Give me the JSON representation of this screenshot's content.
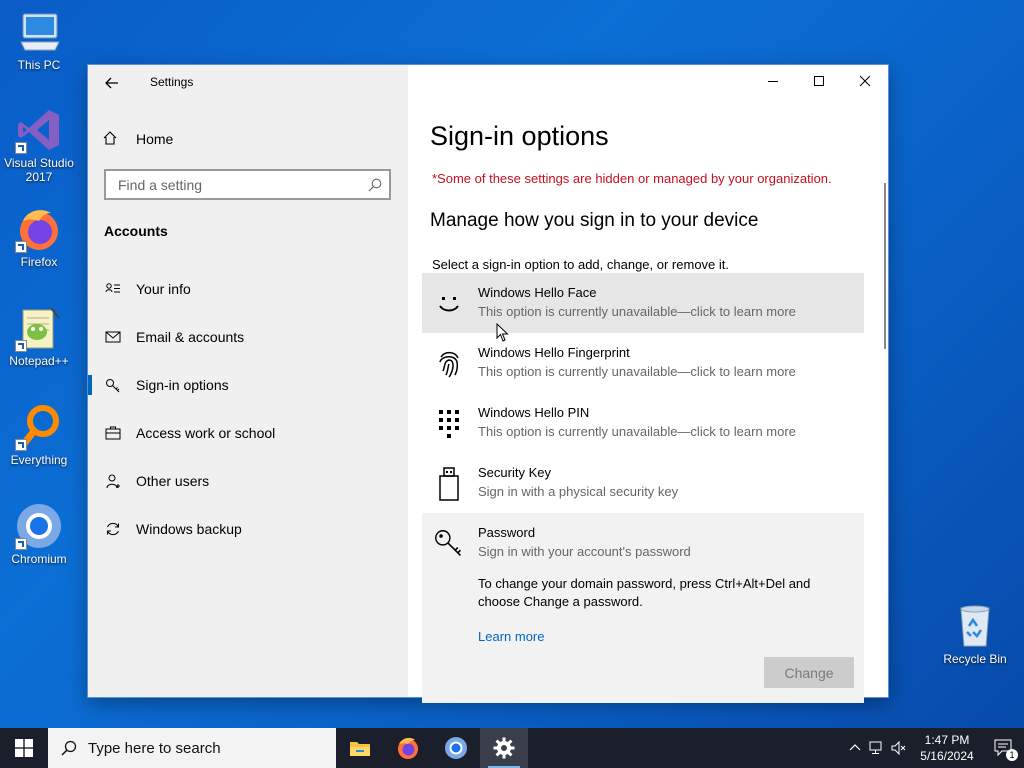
{
  "desktop": {
    "icons": [
      {
        "label": "This PC"
      },
      {
        "label": "Visual Studio 2017"
      },
      {
        "label": "Firefox"
      },
      {
        "label": "Notepad++"
      },
      {
        "label": "Everything"
      },
      {
        "label": "Chromium"
      },
      {
        "label": "Recycle Bin"
      }
    ]
  },
  "window": {
    "app_title": "Settings",
    "nav_home": "Home",
    "search_placeholder": "Find a setting",
    "section_title": "Accounts",
    "nav_items": [
      {
        "label": "Your info",
        "icon": "person-card-icon"
      },
      {
        "label": "Email & accounts",
        "icon": "mail-icon"
      },
      {
        "label": "Sign-in options",
        "icon": "key-icon",
        "active": true
      },
      {
        "label": "Access work or school",
        "icon": "briefcase-icon"
      },
      {
        "label": "Other users",
        "icon": "person-add-icon"
      },
      {
        "label": "Windows backup",
        "icon": "sync-icon"
      }
    ],
    "page_title": "Sign-in options",
    "org_notice": "*Some of these settings are hidden or managed by your organization.",
    "sub_title": "Manage how you sign in to your device",
    "instruction": "Select a sign-in option to add, change, or remove it.",
    "options": [
      {
        "title": "Windows Hello Face",
        "desc": "This option is currently unavailable—click to learn more",
        "icon": "face-icon"
      },
      {
        "title": "Windows Hello Fingerprint",
        "desc": "This option is currently unavailable—click to learn more",
        "icon": "fingerprint-icon"
      },
      {
        "title": "Windows Hello PIN",
        "desc": "This option is currently unavailable—click to learn more",
        "icon": "pin-keypad-icon"
      },
      {
        "title": "Security Key",
        "desc": "Sign in with a physical security key",
        "icon": "usb-key-icon"
      },
      {
        "title": "Password",
        "desc": "Sign in with your account's password",
        "icon": "password-key-icon",
        "note": "To change your domain password, press Ctrl+Alt+Del and choose Change a password.",
        "learn_more": "Learn more",
        "button": "Change"
      }
    ]
  },
  "taskbar": {
    "search_placeholder": "Type here to search",
    "time": "1:47 PM",
    "date": "5/16/2024",
    "notification_count": "1"
  },
  "colors": {
    "accent": "#0067c0",
    "warning_text": "#c50f1f",
    "desktop_bg": "#0a63c9",
    "taskbar_bg": "#1b1f2b"
  }
}
